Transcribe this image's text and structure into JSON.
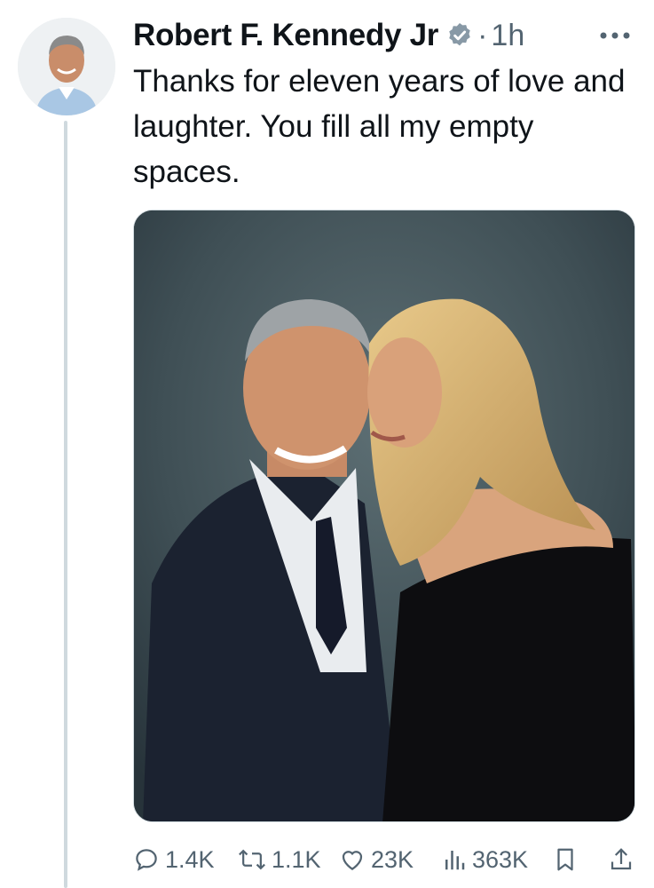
{
  "author": {
    "name": "Robert F. Kennedy Jr",
    "verified": true,
    "avatar_icon": "profile-photo"
  },
  "meta": {
    "separator": "·",
    "timestamp": "1h"
  },
  "tweet": {
    "text": "Thanks for eleven years of love and laughter. You fill all my empty spaces."
  },
  "media": {
    "type": "photo",
    "description_icon": "couple-portrait-photo"
  },
  "actions": {
    "replies": "1.4K",
    "reposts": "1.1K",
    "likes": "23K",
    "views": "363K"
  },
  "colors": {
    "text": "#0f1419",
    "secondary": "#536471",
    "verified_blue": "#1d9bf0",
    "thread_line": "#cfd9de"
  }
}
